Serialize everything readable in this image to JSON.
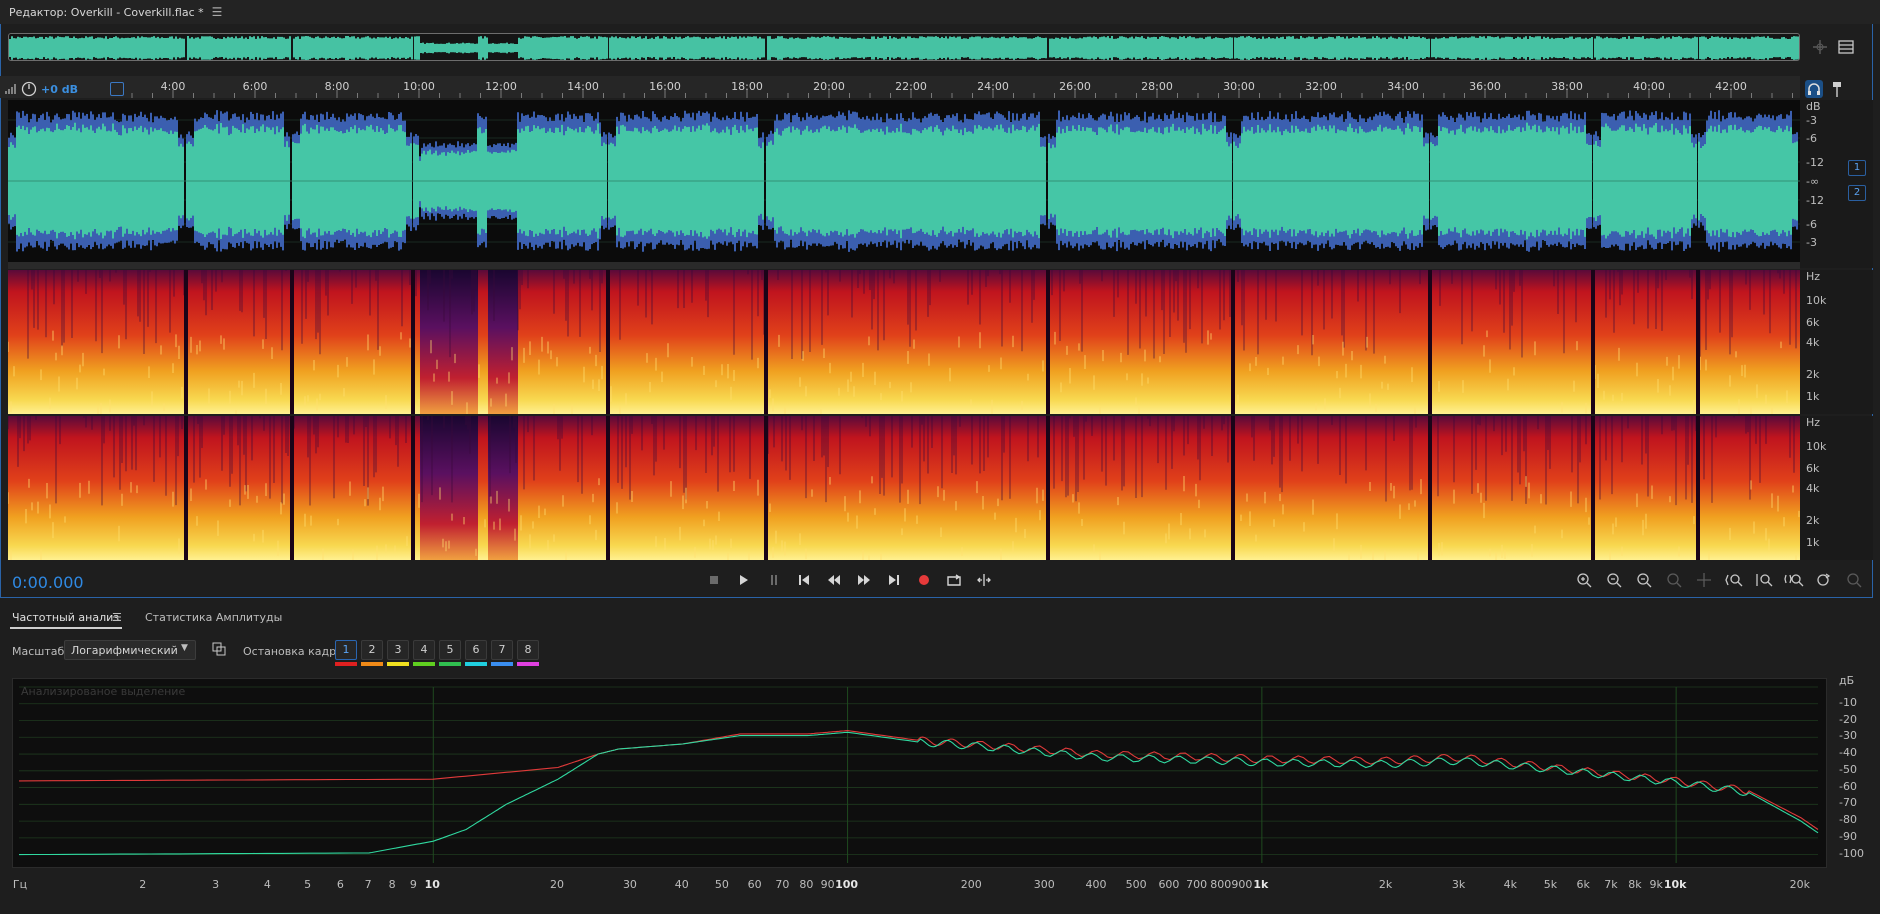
{
  "editor": {
    "title": "Редактор: Overkill - Coverkill.flac *",
    "gain": "+0 dB",
    "time": "0:00.000"
  },
  "ruler": {
    "labels": [
      "4:00",
      "6:00",
      "8:00",
      "10:00",
      "12:00",
      "14:00",
      "16:00",
      "18:00",
      "20:00",
      "22:00",
      "24:00",
      "26:00",
      "28:00",
      "30:00",
      "32:00",
      "34:00",
      "36:00",
      "38:00",
      "40:00",
      "42:00"
    ]
  },
  "waveform": {
    "db_labels": [
      "dB",
      "-3",
      "-6",
      "-12",
      "-∞",
      "-12",
      "-6",
      "-3"
    ],
    "channels": [
      "1",
      "2"
    ],
    "color": "#45c6a6"
  },
  "spectral": {
    "hz_labels": [
      "Hz",
      "10k",
      "6k",
      "4k",
      "2k",
      "1k"
    ]
  },
  "panel": {
    "tab_freq": "Частотный анализ",
    "tab_amp": "Статистика Амплитуды",
    "scale_label": "Масштаб:",
    "scale_value": "Логарифмический",
    "freeze_label": "Остановка кадра:",
    "frames": [
      "1",
      "2",
      "3",
      "4",
      "5",
      "6",
      "7",
      "8"
    ],
    "frame_colors": [
      "#e02020",
      "#f08a18",
      "#f0e020",
      "#60d020",
      "#30c050",
      "#20d0e0",
      "#3a8ef0",
      "#e040e0"
    ],
    "plot_title": "Анализированое выделение",
    "db_unit": "дБ",
    "db_ticks": [
      "-10",
      "-20",
      "-30",
      "-40",
      "-50",
      "-60",
      "-70",
      "-80",
      "-90",
      "-100"
    ],
    "x_unit": "Гц",
    "x_ticks": [
      {
        "label": "2",
        "f": 2
      },
      {
        "label": "3",
        "f": 3
      },
      {
        "label": "4",
        "f": 4
      },
      {
        "label": "5",
        "f": 5
      },
      {
        "label": "6",
        "f": 6
      },
      {
        "label": "7",
        "f": 7
      },
      {
        "label": "8",
        "f": 8
      },
      {
        "label": "9",
        "f": 9
      },
      {
        "label": "10",
        "f": 10,
        "bold": true
      },
      {
        "label": "20",
        "f": 20
      },
      {
        "label": "30",
        "f": 30
      },
      {
        "label": "40",
        "f": 40
      },
      {
        "label": "50",
        "f": 50
      },
      {
        "label": "60",
        "f": 60
      },
      {
        "label": "70",
        "f": 70
      },
      {
        "label": "80",
        "f": 80
      },
      {
        "label": "90",
        "f": 90
      },
      {
        "label": "100",
        "f": 100,
        "bold": true
      },
      {
        "label": "200",
        "f": 200
      },
      {
        "label": "300",
        "f": 300
      },
      {
        "label": "400",
        "f": 400
      },
      {
        "label": "500",
        "f": 500
      },
      {
        "label": "600",
        "f": 600
      },
      {
        "label": "700",
        "f": 700
      },
      {
        "label": "800",
        "f": 800
      },
      {
        "label": "900",
        "f": 900
      },
      {
        "label": "1k",
        "f": 1000,
        "bold": true
      },
      {
        "label": "2k",
        "f": 2000
      },
      {
        "label": "3k",
        "f": 3000
      },
      {
        "label": "4k",
        "f": 4000
      },
      {
        "label": "5k",
        "f": 5000
      },
      {
        "label": "6k",
        "f": 6000
      },
      {
        "label": "7k",
        "f": 7000
      },
      {
        "label": "8k",
        "f": 8000
      },
      {
        "label": "9k",
        "f": 9000
      },
      {
        "label": "10k",
        "f": 10000,
        "bold": true
      },
      {
        "label": "20k",
        "f": 20000
      }
    ]
  },
  "chart_data": {
    "type": "line",
    "xscale": "log",
    "xlim": [
      1,
      22000
    ],
    "ylim": [
      -105,
      0
    ],
    "series": [
      {
        "color": "#e03a3a",
        "x": [
          1,
          10,
          20,
          25,
          28,
          40,
          55,
          80,
          100,
          150,
          200,
          400,
          800,
          1000,
          2000,
          3000,
          5000,
          10000,
          15000,
          20000,
          22000
        ],
        "y": [
          -56,
          -55,
          -48,
          -40,
          -37,
          -34,
          -28,
          -28,
          -26,
          -32,
          -34,
          -40,
          -42,
          -43,
          -44,
          -42,
          -48,
          -56,
          -62,
          -78,
          -85
        ]
      },
      {
        "color": "#30d9a0",
        "x": [
          1,
          7,
          10,
          12,
          15,
          20,
          25,
          28,
          40,
          55,
          80,
          100,
          150,
          200,
          400,
          800,
          1000,
          2000,
          3000,
          5000,
          10000,
          15000,
          20000,
          22000
        ],
        "y": [
          -100,
          -99,
          -92,
          -85,
          -70,
          -55,
          -40,
          -37,
          -34,
          -29,
          -29,
          -27,
          -33,
          -35,
          -42,
          -44,
          -45,
          -46,
          -44,
          -49,
          -57,
          -63,
          -80,
          -87
        ]
      }
    ]
  }
}
